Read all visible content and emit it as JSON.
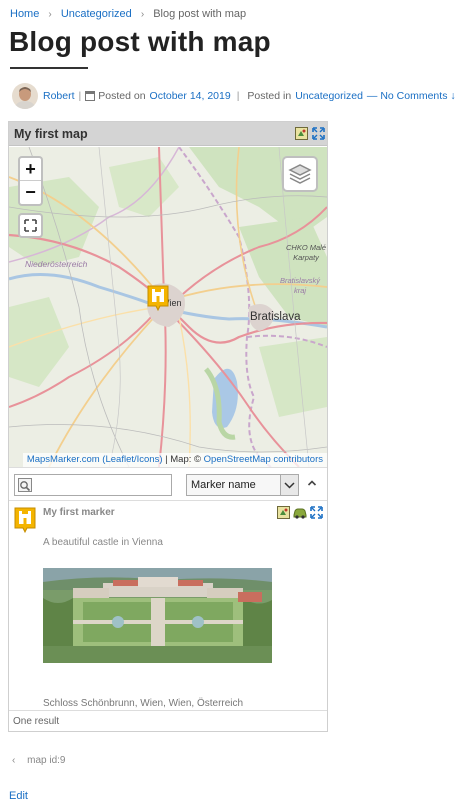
{
  "breadcrumb": {
    "home": "Home",
    "category": "Uncategorized",
    "current": "Blog post with map",
    "separator": "›"
  },
  "post": {
    "title": "Blog post with map",
    "author": "Robert",
    "posted_on_label": "Posted on",
    "date": "October 14, 2019",
    "posted_in_label": "Posted in",
    "category": "Uncategorized",
    "comments": "— No Comments ↓",
    "edit_label": "Edit"
  },
  "map": {
    "title": "My first map",
    "zoom_in": "+",
    "zoom_out": "−",
    "attribution_leaflet": "MapsMarker.com (Leaflet/Icons)",
    "attribution_sep": "| Map: ©",
    "attribution_osm": "OpenStreetMap contributors",
    "id_label": "map id:9",
    "places": {
      "city_main": "Bratislava",
      "city_vienna": "Wien",
      "region": "Niederösterreich",
      "protected_area": "CHKO Malé Karpaty",
      "region_sk": "Bratislavský kraj"
    }
  },
  "marker_list": {
    "search_placeholder": "",
    "sort_by": "Marker name",
    "marker_name": "My first marker",
    "marker_description": "A beautiful castle in Vienna",
    "marker_address": "Schloss Schönbrunn, Wien, Wien, Österreich",
    "result_count": "One result"
  },
  "colors": {
    "link": "#1a6fc4",
    "header_bg": "#d4d4d4",
    "marker_yellow": "#f4b400"
  }
}
